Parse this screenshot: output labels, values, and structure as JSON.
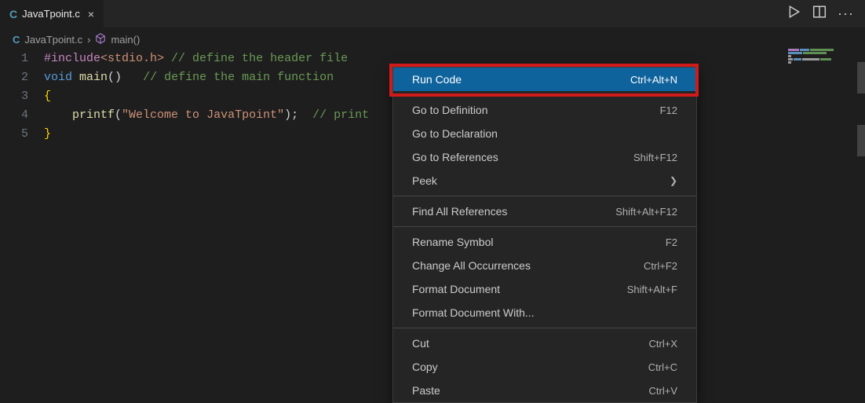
{
  "tab": {
    "filename": "JavaTpoint.c",
    "close_glyph": "×"
  },
  "breadcrumb": {
    "file": "JavaTpoint.c",
    "separator": "›",
    "symbol": "main()"
  },
  "code": {
    "lines": [
      {
        "num": "1",
        "tokens": [
          {
            "cls": "pp",
            "t": "#include"
          },
          {
            "cls": "string-inc",
            "t": "<stdio.h>"
          },
          {
            "cls": "plain",
            "t": " "
          },
          {
            "cls": "comment",
            "t": "// define the header file"
          }
        ]
      },
      {
        "num": "2",
        "tokens": [
          {
            "cls": "type",
            "t": "void"
          },
          {
            "cls": "plain",
            "t": " "
          },
          {
            "cls": "fn",
            "t": "main"
          },
          {
            "cls": "paren",
            "t": "()"
          },
          {
            "cls": "plain",
            "t": "   "
          },
          {
            "cls": "comment",
            "t": "// define the main function"
          }
        ]
      },
      {
        "num": "3",
        "tokens": [
          {
            "cls": "brace",
            "t": "{"
          }
        ]
      },
      {
        "num": "4",
        "tokens": [
          {
            "cls": "plain",
            "t": "    "
          },
          {
            "cls": "fn",
            "t": "printf"
          },
          {
            "cls": "paren",
            "t": "("
          },
          {
            "cls": "str",
            "t": "\"Welcome to JavaTpoint\""
          },
          {
            "cls": "paren",
            "t": ")"
          },
          {
            "cls": "plain",
            "t": ";  "
          },
          {
            "cls": "comment",
            "t": "// print"
          }
        ]
      },
      {
        "num": "5",
        "tokens": [
          {
            "cls": "brace",
            "t": "}"
          }
        ]
      }
    ]
  },
  "context_menu": {
    "items": [
      {
        "label": "Run Code",
        "shortcut": "Ctrl+Alt+N",
        "highlighted": true
      },
      {
        "separator": true
      },
      {
        "label": "Go to Definition",
        "shortcut": "F12"
      },
      {
        "label": "Go to Declaration",
        "shortcut": ""
      },
      {
        "label": "Go to References",
        "shortcut": "Shift+F12"
      },
      {
        "label": "Peek",
        "submenu": true
      },
      {
        "separator": true
      },
      {
        "label": "Find All References",
        "shortcut": "Shift+Alt+F12"
      },
      {
        "separator": true
      },
      {
        "label": "Rename Symbol",
        "shortcut": "F2"
      },
      {
        "label": "Change All Occurrences",
        "shortcut": "Ctrl+F2"
      },
      {
        "label": "Format Document",
        "shortcut": "Shift+Alt+F"
      },
      {
        "label": "Format Document With...",
        "shortcut": ""
      },
      {
        "separator": true
      },
      {
        "label": "Cut",
        "shortcut": "Ctrl+X"
      },
      {
        "label": "Copy",
        "shortcut": "Ctrl+C"
      },
      {
        "label": "Paste",
        "shortcut": "Ctrl+V"
      }
    ]
  }
}
